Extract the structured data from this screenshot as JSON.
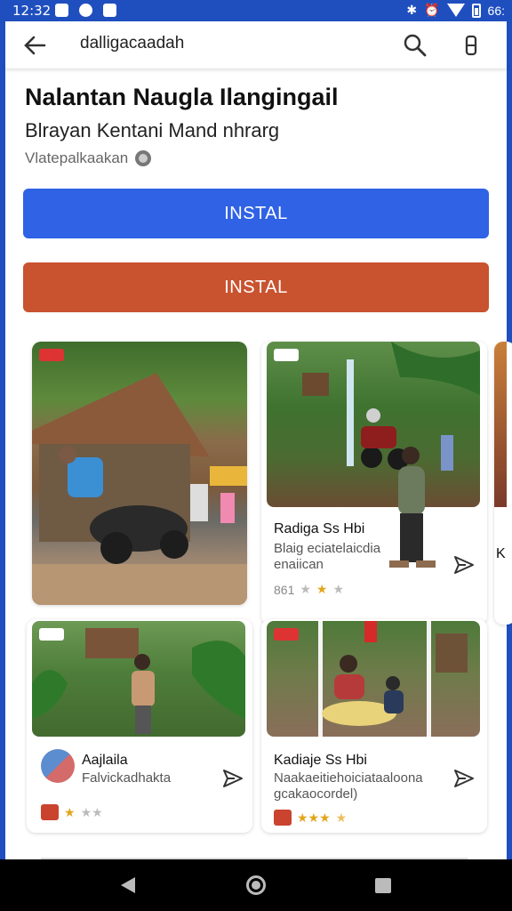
{
  "status_bar": {
    "time": "12:32",
    "battery": "66:"
  },
  "toolbar": {
    "search_text": "dalligacaadah"
  },
  "app": {
    "title": "Nalantan Naugla Ilangingail",
    "subtitle": "Blrayan Kentani Mand nhrarg",
    "meta": "Vlatepalkaakan"
  },
  "buttons": {
    "primary_label": "INSTAL",
    "secondary_label": "INSTAL"
  },
  "cards": [
    {
      "name": "Radiga Ss Hbi",
      "sub1": "Blaig eciatelaicdia",
      "sub2": "enaiican",
      "rating_text": "861"
    },
    {
      "name": "Aajlaila",
      "sub1": "Falvickadhakta"
    },
    {
      "name": "Kadiaje Ss Hbi",
      "sub1": "Naakaeitiehoiciataaloona",
      "sub2": "gcakaocordel)"
    }
  ],
  "partial_card": {
    "letter": "K"
  },
  "colors": {
    "status_bar": "#1f4fbf",
    "primary_button": "#2f62e4",
    "secondary_button": "#c9532f",
    "star": "#e3a51a"
  }
}
